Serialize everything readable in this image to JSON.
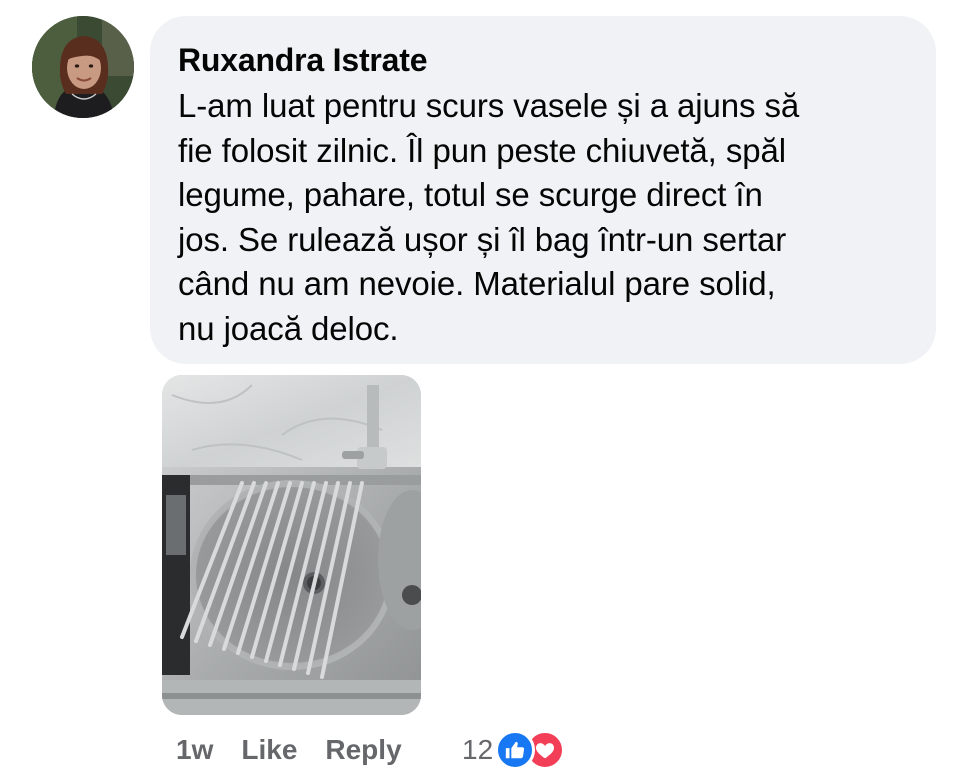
{
  "comment": {
    "author": "Ruxandra Istrate",
    "text": "L-am luat pentru scurs vasele și a ajuns să fie folosit zilnic. Îl pun peste chiuvetă, spăl legume, pahare, totul se scurge direct în jos. Se rulează ușor și îl bag într-un sertar când nu am nevoie. Materialul pare solid, nu joacă deloc.",
    "lines": [
      "L-am luat pentru scurs vasele și a ajuns să",
      "fie folosit zilnic. Îl pun peste chiuvetă, spăl",
      "legume, pahare, totul se scurge direct în",
      "jos. Se rulează ușor și îl bag într-un sertar",
      "când nu am nevoie. Materialul pare solid,",
      "nu joacă deloc."
    ],
    "avatar_icon": "profile-photo",
    "photo_icon": "sink-with-roll-up-dish-rack-photo"
  },
  "actions": {
    "time": "1w",
    "like_label": "Like",
    "reply_label": "Reply"
  },
  "reactions": {
    "count": "12",
    "types": [
      "like-icon",
      "love-icon"
    ],
    "like_color": "#1877f2",
    "love_color": "#f33e58"
  },
  "colors": {
    "bubble": "#f0f2f5",
    "meta_text": "#65676b"
  }
}
